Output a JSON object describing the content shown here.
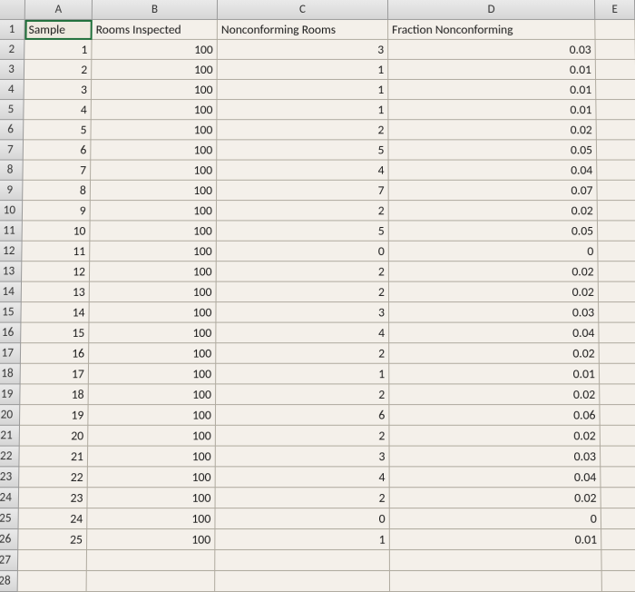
{
  "columns": [
    "A",
    "B",
    "C",
    "D",
    "E"
  ],
  "headers": {
    "A": "Sample",
    "B": "Rooms Inspected",
    "C": "Nonconforming Rooms",
    "D": "Fraction Nonconforming"
  },
  "rows": [
    {
      "r": 1
    },
    {
      "r": 2,
      "A": "1",
      "B": "100",
      "C": "3",
      "D": "0.03"
    },
    {
      "r": 3,
      "A": "2",
      "B": "100",
      "C": "1",
      "D": "0.01"
    },
    {
      "r": 4,
      "A": "3",
      "B": "100",
      "C": "1",
      "D": "0.01"
    },
    {
      "r": 5,
      "A": "4",
      "B": "100",
      "C": "1",
      "D": "0.01"
    },
    {
      "r": 6,
      "A": "5",
      "B": "100",
      "C": "2",
      "D": "0.02"
    },
    {
      "r": 7,
      "A": "6",
      "B": "100",
      "C": "5",
      "D": "0.05"
    },
    {
      "r": 8,
      "A": "7",
      "B": "100",
      "C": "4",
      "D": "0.04"
    },
    {
      "r": 9,
      "A": "8",
      "B": "100",
      "C": "7",
      "D": "0.07"
    },
    {
      "r": 10,
      "A": "9",
      "B": "100",
      "C": "2",
      "D": "0.02"
    },
    {
      "r": 11,
      "A": "10",
      "B": "100",
      "C": "5",
      "D": "0.05"
    },
    {
      "r": 12,
      "A": "11",
      "B": "100",
      "C": "0",
      "D": "0"
    },
    {
      "r": 13,
      "A": "12",
      "B": "100",
      "C": "2",
      "D": "0.02"
    },
    {
      "r": 14,
      "A": "13",
      "B": "100",
      "C": "2",
      "D": "0.02"
    },
    {
      "r": 15,
      "A": "14",
      "B": "100",
      "C": "3",
      "D": "0.03"
    },
    {
      "r": 16,
      "A": "15",
      "B": "100",
      "C": "4",
      "D": "0.04"
    },
    {
      "r": 17,
      "A": "16",
      "B": "100",
      "C": "2",
      "D": "0.02"
    },
    {
      "r": 18,
      "A": "17",
      "B": "100",
      "C": "1",
      "D": "0.01"
    },
    {
      "r": 19,
      "A": "18",
      "B": "100",
      "C": "2",
      "D": "0.02"
    },
    {
      "r": 20,
      "A": "19",
      "B": "100",
      "C": "6",
      "D": "0.06"
    },
    {
      "r": 21,
      "A": "20",
      "B": "100",
      "C": "2",
      "D": "0.02"
    },
    {
      "r": 22,
      "A": "21",
      "B": "100",
      "C": "3",
      "D": "0.03"
    },
    {
      "r": 23,
      "A": "22",
      "B": "100",
      "C": "4",
      "D": "0.04"
    },
    {
      "r": 24,
      "A": "23",
      "B": "100",
      "C": "2",
      "D": "0.02"
    },
    {
      "r": 25,
      "A": "24",
      "B": "100",
      "C": "0",
      "D": "0"
    },
    {
      "r": 26,
      "A": "25",
      "B": "100",
      "C": "1",
      "D": "0.01"
    },
    {
      "r": 27
    },
    {
      "r": 28
    }
  ],
  "selected_cell": "A1"
}
